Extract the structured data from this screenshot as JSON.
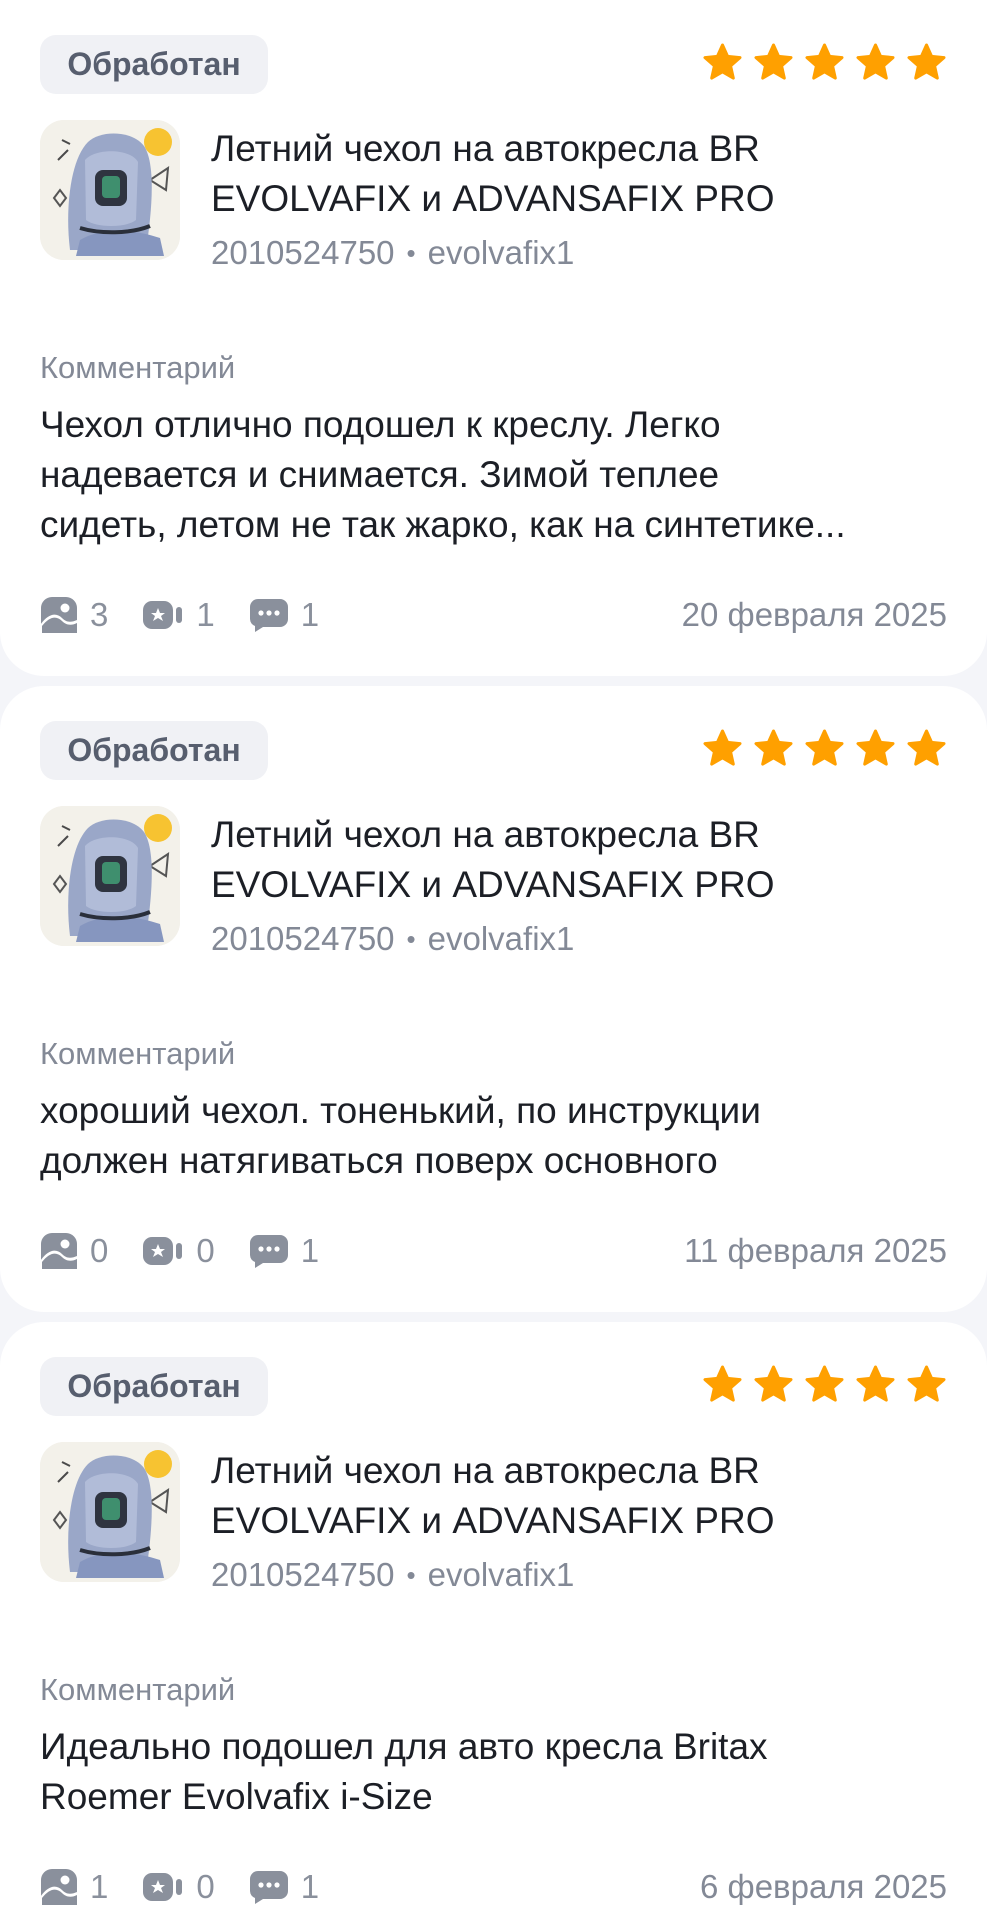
{
  "reviews": [
    {
      "status": "Обработан",
      "rating": 5,
      "product_title": "Летний чехол на автокресла BR EVOLVAFIX и ADVANSAFIX PRO",
      "sku": "2010524750",
      "article": "evolvafix1",
      "comment_label": "Комментарий",
      "comment_lines": [
        "Чехол отлично подошел к креслу. Легко",
        "надевается и снимается. Зимой теплее",
        "сидеть, летом не так жарко, как на синтетике..."
      ],
      "photos_count": "3",
      "videos_count": "1",
      "replies_count": "1",
      "date": "20 февраля 2025"
    },
    {
      "status": "Обработан",
      "rating": 5,
      "product_title": "Летний чехол на автокресла BR EVOLVAFIX и ADVANSAFIX PRO",
      "sku": "2010524750",
      "article": "evolvafix1",
      "comment_label": "Комментарий",
      "comment_lines": [
        "хороший чехол. тоненький, по инструкции",
        "должен натягиваться поверх основного"
      ],
      "photos_count": "0",
      "videos_count": "0",
      "replies_count": "1",
      "date": "11 февраля 2025"
    },
    {
      "status": "Обработан",
      "rating": 5,
      "product_title": "Летний чехол на автокресла BR EVOLVAFIX и ADVANSAFIX PRO",
      "sku": "2010524750",
      "article": "evolvafix1",
      "comment_label": "Комментарий",
      "comment_lines": [
        "Идеально подошел для авто кресла Britax",
        "Roemer Evolvafix i-Size"
      ],
      "photos_count": "1",
      "videos_count": "0",
      "replies_count": "1",
      "date": "6 февраля 2025"
    }
  ],
  "colors": {
    "star": "#ffa000",
    "status_bg": "#f0f1f5",
    "muted_text": "#838996",
    "icon": "#8a909c"
  },
  "icons": {
    "photo": "photo-icon",
    "video": "video-icon",
    "reply": "reply-icon",
    "star": "star-icon"
  }
}
